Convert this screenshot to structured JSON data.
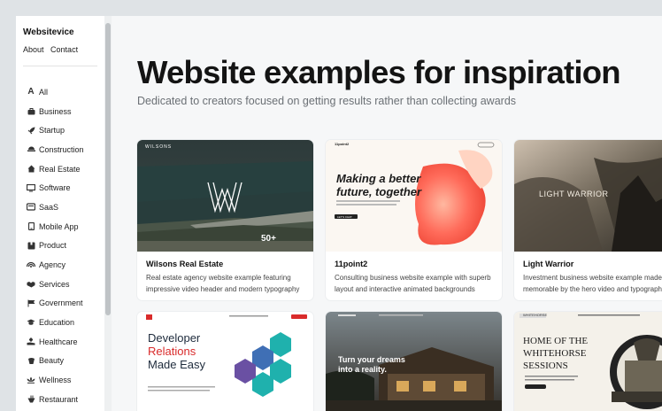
{
  "sidebar": {
    "brand": "Websitevice",
    "links": [
      "About",
      "Contact"
    ],
    "items": [
      {
        "label": "All",
        "icon": "font-icon"
      },
      {
        "label": "Business",
        "icon": "briefcase-icon"
      },
      {
        "label": "Startup",
        "icon": "rocket-icon"
      },
      {
        "label": "Construction",
        "icon": "crane-icon"
      },
      {
        "label": "Real Estate",
        "icon": "house-icon"
      },
      {
        "label": "Software",
        "icon": "monitor-icon"
      },
      {
        "label": "SaaS",
        "icon": "cloud-icon"
      },
      {
        "label": "Mobile App",
        "icon": "phone-icon"
      },
      {
        "label": "Product",
        "icon": "box-icon"
      },
      {
        "label": "Agency",
        "icon": "megaphone-icon"
      },
      {
        "label": "Services",
        "icon": "handshake-icon"
      },
      {
        "label": "Government",
        "icon": "flag-icon"
      },
      {
        "label": "Education",
        "icon": "graduation-cap-icon"
      },
      {
        "label": "Healthcare",
        "icon": "medical-hand-icon"
      },
      {
        "label": "Beauty",
        "icon": "spa-icon"
      },
      {
        "label": "Wellness",
        "icon": "lotus-icon"
      },
      {
        "label": "Restaurant",
        "icon": "utensils-icon"
      }
    ]
  },
  "main": {
    "title": "Website examples for inspiration",
    "subtitle": "Dedicated to creators focused on getting results rather than collecting awards"
  },
  "cards": [
    {
      "title": "Wilsons Real Estate",
      "desc": "Real estate agency website example featuring impressive video header and modern typography",
      "thumb": {
        "brand": "WILSONS",
        "badge": "50+"
      }
    },
    {
      "title": "11point2",
      "desc": "Consulting business website example with superb layout and interactive animated backgrounds",
      "thumb": {
        "brand": "11point2",
        "headline": "Making a better future, together",
        "cta": "LET'S CHAT"
      }
    },
    {
      "title": "Light Warrior",
      "desc": "Investment business website example made memorable by the hero video and typography",
      "thumb": {
        "headline": "LIGHT WARRIOR"
      }
    }
  ],
  "cards_row2": [
    {
      "thumb": {
        "headline_lines": [
          "Developer",
          "Relations",
          "Made Easy"
        ]
      }
    },
    {
      "thumb": {
        "headline_lines": [
          "Turn your dreams",
          "into a reality."
        ]
      }
    },
    {
      "thumb": {
        "brand": "WHITEHORSE",
        "headline_lines": [
          "HOME OF THE",
          "WHITEHORSE",
          "SESSIONS"
        ]
      }
    }
  ]
}
